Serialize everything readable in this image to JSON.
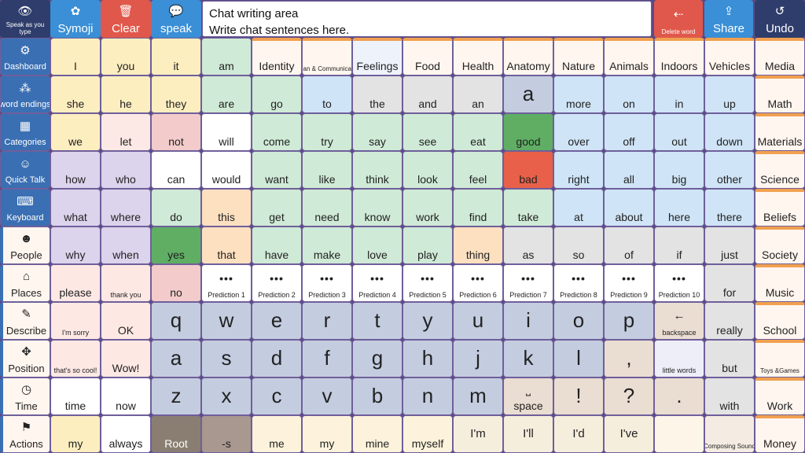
{
  "chat": {
    "title": "Chat writing area",
    "placeholder": "Write chat sentences here."
  },
  "colors": {
    "pronoun": "#fdeec0",
    "verb": "#cfead6",
    "question": "#dcd3ec",
    "determiner": "#e3e3e3",
    "preposition": "#cfe4f6",
    "negative": "#f3cbcb",
    "conjunction": "#f0e5d8",
    "keyboard": "#c4cde0",
    "folder": "#fff6ef",
    "nav": "#3a6fb3"
  },
  "top_buttons": [
    {
      "label": "Speak as you type",
      "icon": "eye-icon"
    },
    {
      "label": "Symoji",
      "icon": "symoji-icon"
    },
    {
      "label": "Clear",
      "icon": "trash-icon"
    },
    {
      "label": "speak",
      "icon": "speech-bubble-icon"
    },
    {
      "label": "Delete word",
      "icon": "delete-word-icon"
    },
    {
      "label": "Share",
      "icon": "share-icon"
    },
    {
      "label": "Undo",
      "icon": "undo-icon"
    }
  ],
  "left_nav": [
    {
      "label": "Dashboard",
      "icon": "dashboard-icon"
    },
    {
      "label": "word endings",
      "icon": "word-endings-icon"
    },
    {
      "label": "Categories",
      "icon": "categories-icon"
    },
    {
      "label": "Quick Talk",
      "icon": "quick-talk-icon"
    },
    {
      "label": "Keyboard",
      "icon": "keyboard-icon"
    },
    {
      "label": "People",
      "icon": "people-icon"
    },
    {
      "label": "Places",
      "icon": "places-icon"
    },
    {
      "label": "Describe",
      "icon": "describe-icon"
    },
    {
      "label": "Position",
      "icon": "position-icon"
    },
    {
      "label": "Time",
      "icon": "clock-icon"
    },
    {
      "label": "Actions",
      "icon": "actions-icon"
    }
  ],
  "rows": [
    [
      "I",
      "you",
      "it",
      "am",
      "Identity",
      "Plan & Communicate",
      "Feelings",
      "Food",
      "Health",
      "Anatomy",
      "Nature",
      "Animals",
      "Indoors",
      "Vehicles",
      "Media"
    ],
    [
      "she",
      "he",
      "they",
      "are",
      "go",
      "to",
      "the",
      "and",
      "an",
      "a",
      "more",
      "on",
      "in",
      "up",
      "Math"
    ],
    [
      "we",
      "let",
      "not",
      "will",
      "come",
      "try",
      "say",
      "see",
      "eat",
      "good",
      "over",
      "off",
      "out",
      "down",
      "Materials"
    ],
    [
      "how",
      "who",
      "can",
      "would",
      "want",
      "like",
      "think",
      "look",
      "feel",
      "bad",
      "right",
      "all",
      "big",
      "other",
      "Science"
    ],
    [
      "what",
      "where",
      "do",
      "this",
      "get",
      "need",
      "know",
      "work",
      "find",
      "take",
      "at",
      "about",
      "here",
      "there",
      "Beliefs"
    ],
    [
      "why",
      "when",
      "yes",
      "that",
      "have",
      "make",
      "love",
      "play",
      "thing",
      "as",
      "so",
      "of",
      "if",
      "just",
      "Society"
    ],
    [
      "please",
      "thank you",
      "no",
      "Prediction 1",
      "Prediction 2",
      "Prediction 3",
      "Prediction 4",
      "Prediction 5",
      "Prediction 6",
      "Prediction 7",
      "Prediction 8",
      "Prediction 9",
      "Prediction 10",
      "for",
      "Music"
    ],
    [
      "I'm sorry",
      "OK",
      "q",
      "w",
      "e",
      "r",
      "t",
      "y",
      "u",
      "i",
      "o",
      "p",
      "backspace",
      "really",
      "School"
    ],
    [
      "that's so cool!",
      "Wow!",
      "a",
      "s",
      "d",
      "f",
      "g",
      "h",
      "j",
      "k",
      "l",
      ",",
      "little words",
      "but",
      "Toys &Games"
    ],
    [
      "time",
      "now",
      "z",
      "x",
      "c",
      "v",
      "b",
      "n",
      "m",
      "space",
      "!",
      "?",
      ".",
      "with",
      "Work"
    ],
    [
      "my",
      "always",
      "Root",
      "-s",
      "me",
      "my",
      "mine",
      "myself",
      "I'm",
      "I'll",
      "I'd",
      "I've",
      "",
      "Composing Sound",
      "Money"
    ]
  ]
}
